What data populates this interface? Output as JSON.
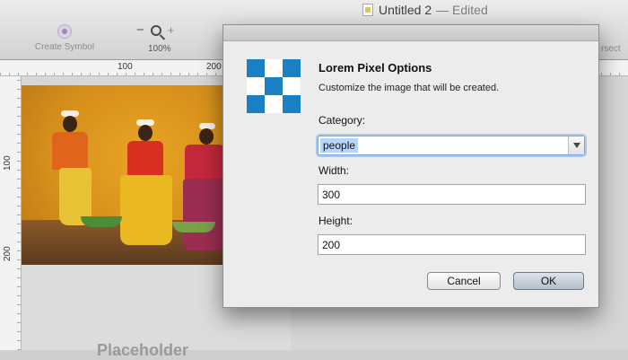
{
  "window": {
    "title": "Untitled 2",
    "status": "— Edited"
  },
  "toolbar": {
    "create_symbol_label": "Create Symbol",
    "zoom_minus": "−",
    "zoom_plus": "+",
    "zoom_value": "100%",
    "right_tool_partial": "rsect"
  },
  "rulers": {
    "top_labels": [
      "100",
      "200"
    ],
    "left_labels": [
      "100",
      "200"
    ]
  },
  "canvas": {
    "placeholder_partial": "Placeholder"
  },
  "dialog": {
    "title": "Lorem Pixel Options",
    "subtitle": "Customize the image that will be created.",
    "category_label": "Category:",
    "category_value": "people",
    "width_label": "Width:",
    "width_value": "300",
    "height_label": "Height:",
    "height_value": "200",
    "cancel_label": "Cancel",
    "ok_label": "OK",
    "logo_cells": [
      "blue",
      "white",
      "blue",
      "white",
      "blue",
      "white",
      "blue",
      "white",
      "blue"
    ]
  },
  "colors": {
    "logo_blue": "#1a80c4",
    "accent_focus": "#7aa7e0"
  }
}
